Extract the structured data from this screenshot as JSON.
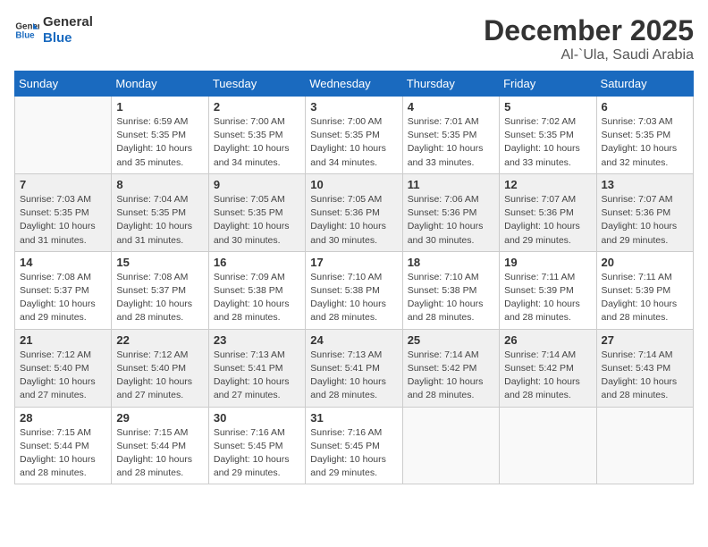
{
  "header": {
    "logo_line1": "General",
    "logo_line2": "Blue",
    "month_year": "December 2025",
    "location": "Al-`Ula, Saudi Arabia"
  },
  "weekdays": [
    "Sunday",
    "Monday",
    "Tuesday",
    "Wednesday",
    "Thursday",
    "Friday",
    "Saturday"
  ],
  "weeks": [
    [
      {
        "day": "",
        "info": ""
      },
      {
        "day": "1",
        "info": "Sunrise: 6:59 AM\nSunset: 5:35 PM\nDaylight: 10 hours\nand 35 minutes."
      },
      {
        "day": "2",
        "info": "Sunrise: 7:00 AM\nSunset: 5:35 PM\nDaylight: 10 hours\nand 34 minutes."
      },
      {
        "day": "3",
        "info": "Sunrise: 7:00 AM\nSunset: 5:35 PM\nDaylight: 10 hours\nand 34 minutes."
      },
      {
        "day": "4",
        "info": "Sunrise: 7:01 AM\nSunset: 5:35 PM\nDaylight: 10 hours\nand 33 minutes."
      },
      {
        "day": "5",
        "info": "Sunrise: 7:02 AM\nSunset: 5:35 PM\nDaylight: 10 hours\nand 33 minutes."
      },
      {
        "day": "6",
        "info": "Sunrise: 7:03 AM\nSunset: 5:35 PM\nDaylight: 10 hours\nand 32 minutes."
      }
    ],
    [
      {
        "day": "7",
        "info": "Sunrise: 7:03 AM\nSunset: 5:35 PM\nDaylight: 10 hours\nand 31 minutes."
      },
      {
        "day": "8",
        "info": "Sunrise: 7:04 AM\nSunset: 5:35 PM\nDaylight: 10 hours\nand 31 minutes."
      },
      {
        "day": "9",
        "info": "Sunrise: 7:05 AM\nSunset: 5:35 PM\nDaylight: 10 hours\nand 30 minutes."
      },
      {
        "day": "10",
        "info": "Sunrise: 7:05 AM\nSunset: 5:36 PM\nDaylight: 10 hours\nand 30 minutes."
      },
      {
        "day": "11",
        "info": "Sunrise: 7:06 AM\nSunset: 5:36 PM\nDaylight: 10 hours\nand 30 minutes."
      },
      {
        "day": "12",
        "info": "Sunrise: 7:07 AM\nSunset: 5:36 PM\nDaylight: 10 hours\nand 29 minutes."
      },
      {
        "day": "13",
        "info": "Sunrise: 7:07 AM\nSunset: 5:36 PM\nDaylight: 10 hours\nand 29 minutes."
      }
    ],
    [
      {
        "day": "14",
        "info": "Sunrise: 7:08 AM\nSunset: 5:37 PM\nDaylight: 10 hours\nand 29 minutes."
      },
      {
        "day": "15",
        "info": "Sunrise: 7:08 AM\nSunset: 5:37 PM\nDaylight: 10 hours\nand 28 minutes."
      },
      {
        "day": "16",
        "info": "Sunrise: 7:09 AM\nSunset: 5:38 PM\nDaylight: 10 hours\nand 28 minutes."
      },
      {
        "day": "17",
        "info": "Sunrise: 7:10 AM\nSunset: 5:38 PM\nDaylight: 10 hours\nand 28 minutes."
      },
      {
        "day": "18",
        "info": "Sunrise: 7:10 AM\nSunset: 5:38 PM\nDaylight: 10 hours\nand 28 minutes."
      },
      {
        "day": "19",
        "info": "Sunrise: 7:11 AM\nSunset: 5:39 PM\nDaylight: 10 hours\nand 28 minutes."
      },
      {
        "day": "20",
        "info": "Sunrise: 7:11 AM\nSunset: 5:39 PM\nDaylight: 10 hours\nand 28 minutes."
      }
    ],
    [
      {
        "day": "21",
        "info": "Sunrise: 7:12 AM\nSunset: 5:40 PM\nDaylight: 10 hours\nand 27 minutes."
      },
      {
        "day": "22",
        "info": "Sunrise: 7:12 AM\nSunset: 5:40 PM\nDaylight: 10 hours\nand 27 minutes."
      },
      {
        "day": "23",
        "info": "Sunrise: 7:13 AM\nSunset: 5:41 PM\nDaylight: 10 hours\nand 27 minutes."
      },
      {
        "day": "24",
        "info": "Sunrise: 7:13 AM\nSunset: 5:41 PM\nDaylight: 10 hours\nand 28 minutes."
      },
      {
        "day": "25",
        "info": "Sunrise: 7:14 AM\nSunset: 5:42 PM\nDaylight: 10 hours\nand 28 minutes."
      },
      {
        "day": "26",
        "info": "Sunrise: 7:14 AM\nSunset: 5:42 PM\nDaylight: 10 hours\nand 28 minutes."
      },
      {
        "day": "27",
        "info": "Sunrise: 7:14 AM\nSunset: 5:43 PM\nDaylight: 10 hours\nand 28 minutes."
      }
    ],
    [
      {
        "day": "28",
        "info": "Sunrise: 7:15 AM\nSunset: 5:44 PM\nDaylight: 10 hours\nand 28 minutes."
      },
      {
        "day": "29",
        "info": "Sunrise: 7:15 AM\nSunset: 5:44 PM\nDaylight: 10 hours\nand 28 minutes."
      },
      {
        "day": "30",
        "info": "Sunrise: 7:16 AM\nSunset: 5:45 PM\nDaylight: 10 hours\nand 29 minutes."
      },
      {
        "day": "31",
        "info": "Sunrise: 7:16 AM\nSunset: 5:45 PM\nDaylight: 10 hours\nand 29 minutes."
      },
      {
        "day": "",
        "info": ""
      },
      {
        "day": "",
        "info": ""
      },
      {
        "day": "",
        "info": ""
      }
    ]
  ]
}
